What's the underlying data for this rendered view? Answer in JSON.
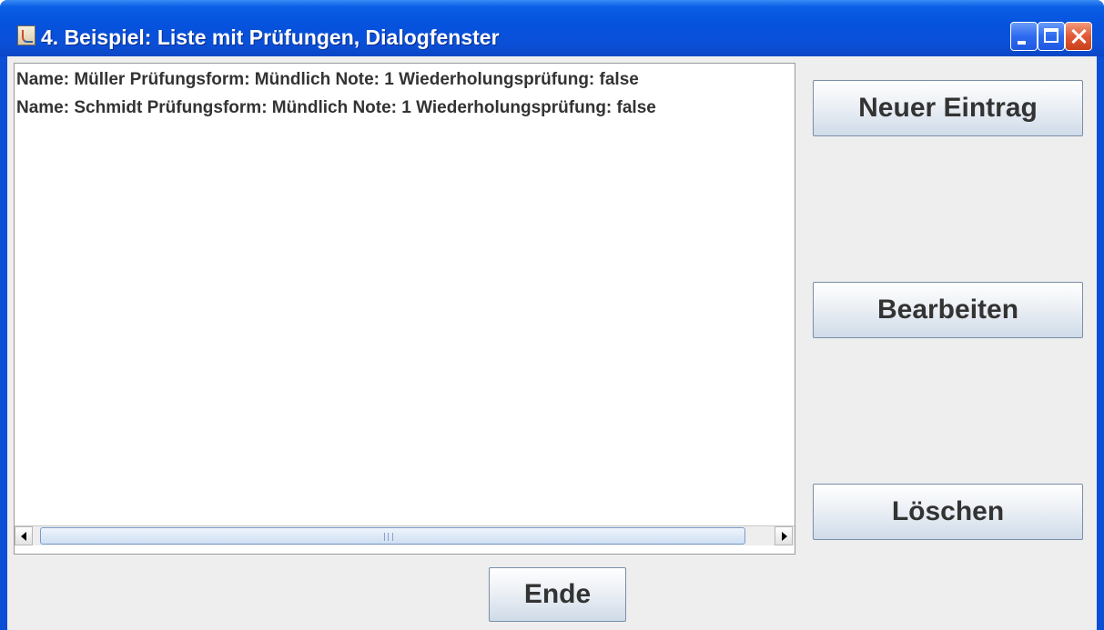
{
  "window": {
    "title": "4. Beispiel: Liste mit Prüfungen, Dialogfenster"
  },
  "list": {
    "items": [
      {
        "text": "Name: Müller   Prüfungsform: Mündlich   Note: 1   Wiederholungsprüfung: false"
      },
      {
        "text": "Name: Schmidt   Prüfungsform: Mündlich   Note: 1   Wiederholungsprüfung: false"
      }
    ]
  },
  "buttons": {
    "new_entry": "Neuer Eintrag",
    "edit": "Bearbeiten",
    "delete": "Löschen",
    "end": "Ende"
  },
  "icons": {
    "app": "java-icon",
    "minimize": "minimize-icon",
    "maximize": "maximize-icon",
    "close": "close-icon",
    "scroll_left": "arrow-left-icon",
    "scroll_right": "arrow-right-icon"
  },
  "colors": {
    "titlebar": "#0552dd",
    "close_button": "#e05a35",
    "client_background": "#eeeeee"
  }
}
